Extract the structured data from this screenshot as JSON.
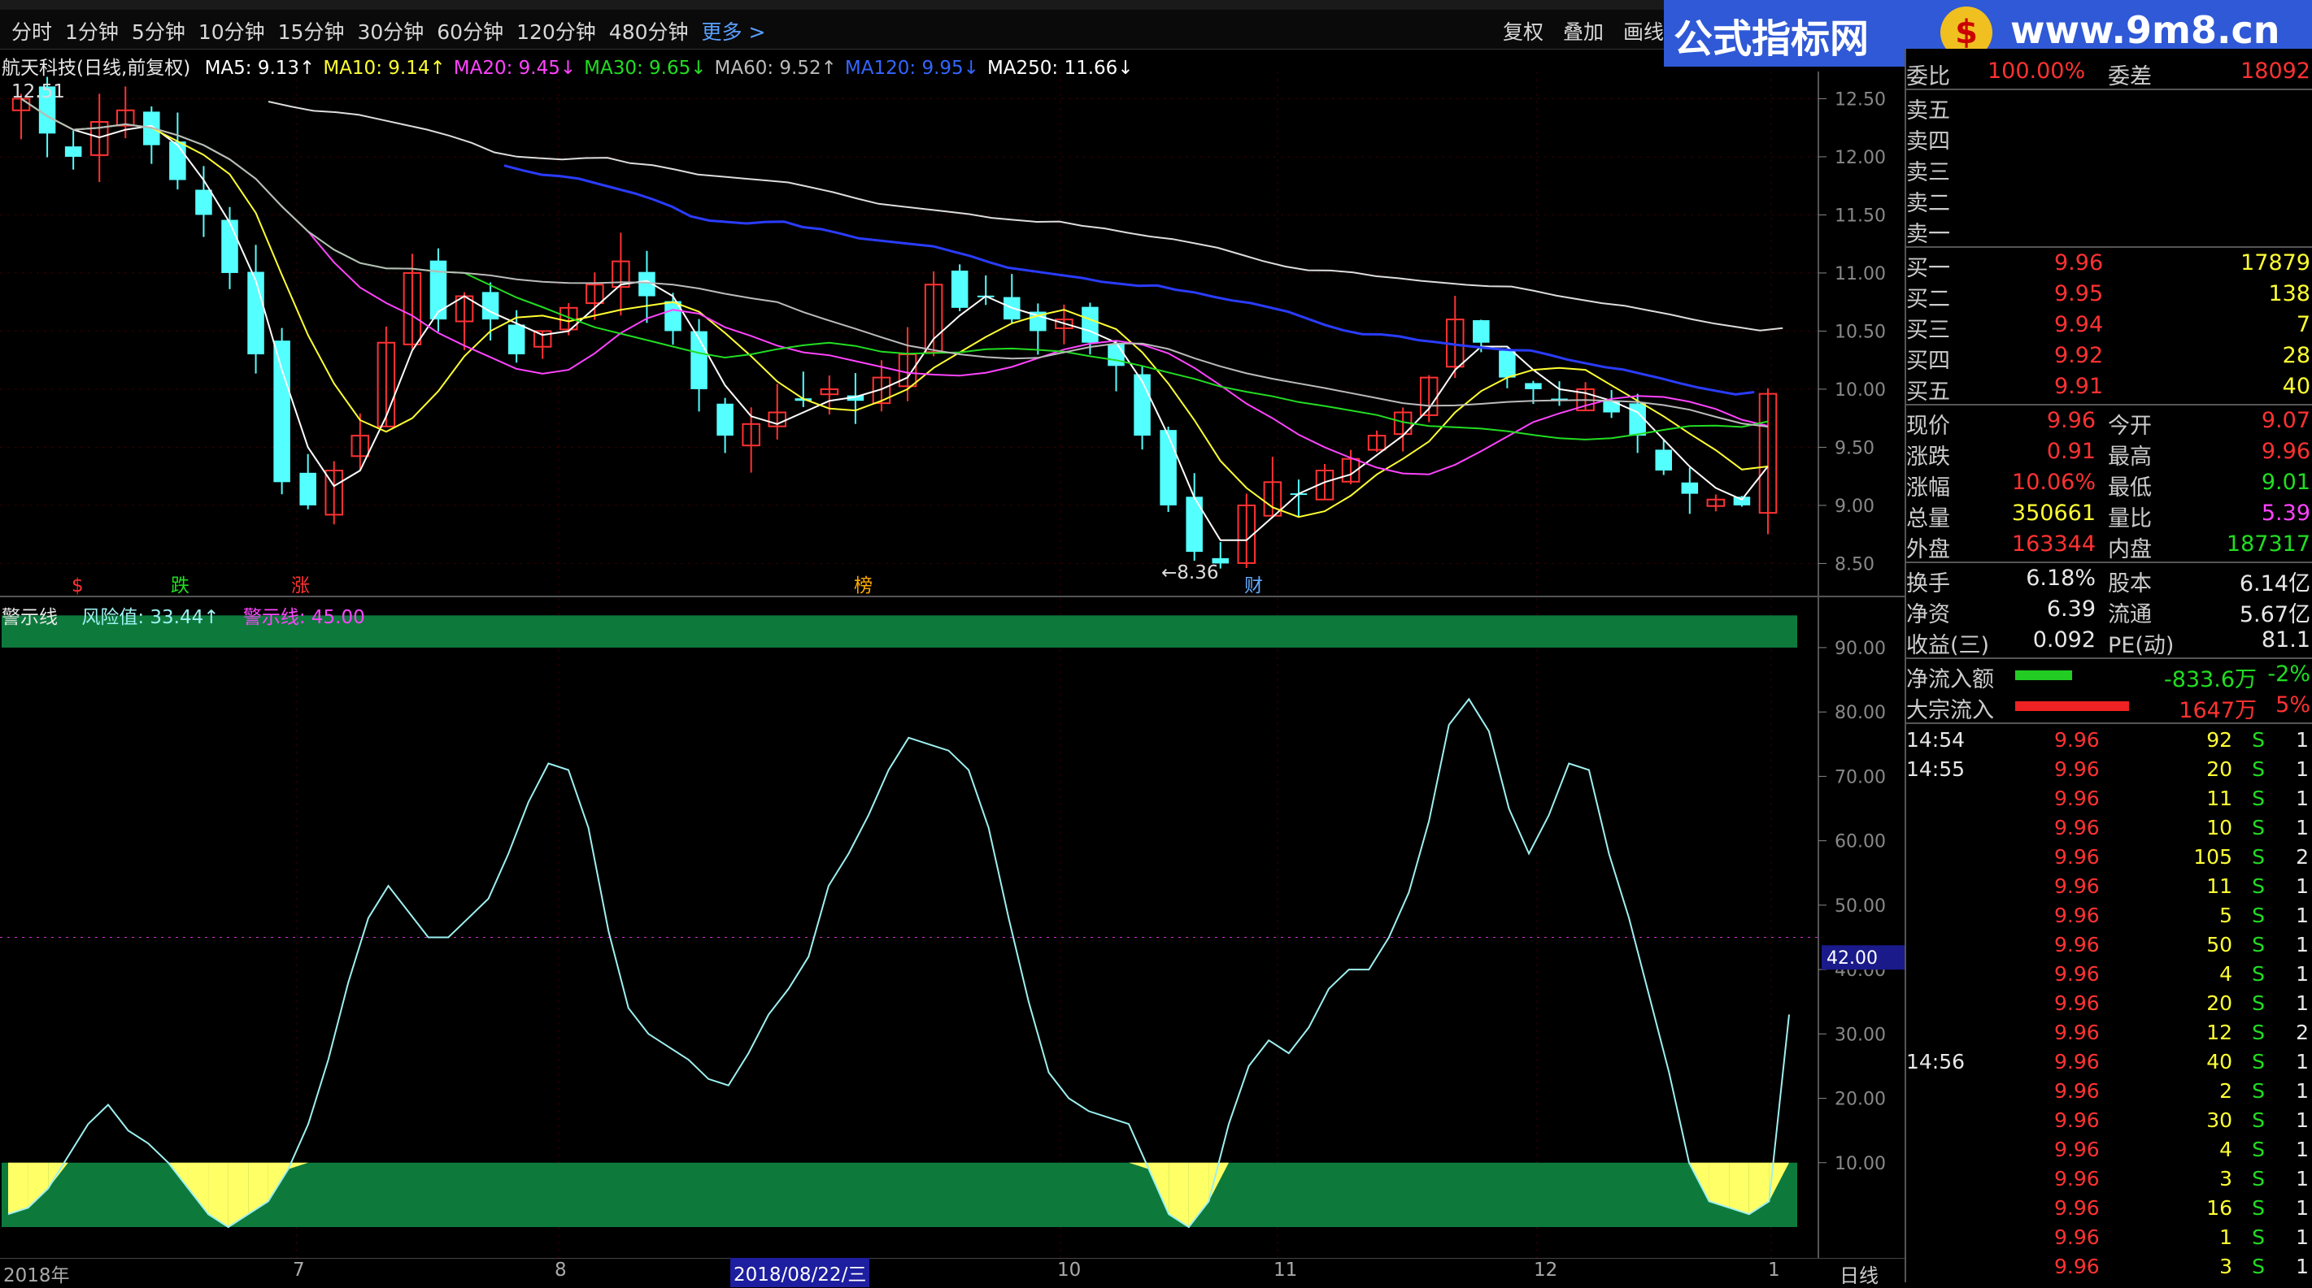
{
  "toolbar": {
    "periods": [
      "分时",
      "1分钟",
      "5分钟",
      "10分钟",
      "15分钟",
      "30分钟",
      "60分钟",
      "120分钟",
      "480分钟",
      "更多 >"
    ],
    "tools": [
      "复权",
      "叠加",
      "画线"
    ]
  },
  "brand": {
    "name": "公式指标网",
    "url": "www.9m8.cn",
    "logo_glyph": "$"
  },
  "chart_header": {
    "title": "航天科技(日线,前复权)",
    "ma": [
      {
        "label": "MA5: 9.13↑",
        "color": "#ffffff"
      },
      {
        "label": "MA10: 9.14↑",
        "color": "#ffff33"
      },
      {
        "label": "MA20: 9.45↓",
        "color": "#ff44ff"
      },
      {
        "label": "MA30: 9.65↓",
        "color": "#22dd22"
      },
      {
        "label": "MA60: 9.52↑",
        "color": "#bbbbbb"
      },
      {
        "label": "MA120: 9.95↓",
        "color": "#3366ff"
      },
      {
        "label": "MA250: 11.66↓",
        "color": "#ffffff"
      }
    ]
  },
  "price_axis": [
    "12.50",
    "12.00",
    "11.50",
    "11.00",
    "10.50",
    "10.00",
    "9.50",
    "9.00",
    "8.50"
  ],
  "high_label": "12.51",
  "low_label": "←8.36",
  "event_markers": [
    {
      "text": "$",
      "color": "#ff3232"
    },
    {
      "text": "跌",
      "color": "#22dd22"
    },
    {
      "text": "涨",
      "color": "#ff3232"
    },
    {
      "text": "榜",
      "color": "#ffaa00"
    },
    {
      "text": "财",
      "color": "#66aaff"
    }
  ],
  "indicator": {
    "name": "警示线",
    "risk_label": "风险值: 33.44↑",
    "warn_label": "警示线: 45.00",
    "axis": [
      "90.00",
      "80.00",
      "70.00",
      "60.00",
      "50.00",
      "40.00",
      "30.00",
      "20.00",
      "10.00"
    ],
    "cursor_value": "42.00"
  },
  "dates": {
    "labels": [
      "2018年",
      "7",
      "8",
      "10",
      "11",
      "12",
      "1"
    ],
    "selected": "2018/08/22/三",
    "mode": "日线"
  },
  "panel": {
    "weibi": {
      "label": "委比",
      "value": "100.00%",
      "label2": "委差",
      "value2": "18092"
    },
    "sell": [
      {
        "label": "卖五"
      },
      {
        "label": "卖四"
      },
      {
        "label": "卖三"
      },
      {
        "label": "卖二"
      },
      {
        "label": "卖一"
      }
    ],
    "buy": [
      {
        "label": "买一",
        "price": "9.96",
        "vol": "17879"
      },
      {
        "label": "买二",
        "price": "9.95",
        "vol": "138"
      },
      {
        "label": "买三",
        "price": "9.94",
        "vol": "7"
      },
      {
        "label": "买四",
        "price": "9.92",
        "vol": "28"
      },
      {
        "label": "买五",
        "price": "9.91",
        "vol": "40"
      }
    ],
    "quote": [
      {
        "l1": "现价",
        "v1": "9.96",
        "l2": "今开",
        "v2": "9.07",
        "c1": "red",
        "c2": "red"
      },
      {
        "l1": "涨跌",
        "v1": "0.91",
        "l2": "最高",
        "v2": "9.96",
        "c1": "red",
        "c2": "red"
      },
      {
        "l1": "涨幅",
        "v1": "10.06%",
        "l2": "最低",
        "v2": "9.01",
        "c1": "red",
        "c2": "green"
      },
      {
        "l1": "总量",
        "v1": "350661",
        "l2": "量比",
        "v2": "5.39",
        "c1": "yellow",
        "c2": "magenta"
      },
      {
        "l1": "外盘",
        "v1": "163344",
        "l2": "内盘",
        "v2": "187317",
        "c1": "red",
        "c2": "green"
      }
    ],
    "fund": [
      {
        "l1": "换手",
        "v1": "6.18%",
        "l2": "股本",
        "v2": "6.14亿"
      },
      {
        "l1": "净资",
        "v1": "6.39",
        "l2": "流通",
        "v2": "5.67亿"
      },
      {
        "l1": "收益(三)",
        "v1": "0.092",
        "l2": "PE(动)",
        "v2": "81.1"
      }
    ],
    "flow": [
      {
        "label": "净流入额",
        "value": "-833.6万",
        "pct": "-2%",
        "color": "green",
        "fill": 0.28
      },
      {
        "label": "大宗流入",
        "value": "1647万",
        "pct": "5%",
        "color": "red",
        "fill": 0.56
      }
    ],
    "ticks": [
      {
        "time": "14:54",
        "price": "9.96",
        "vol": "92",
        "side": "S",
        "n": "1"
      },
      {
        "time": "14:55",
        "price": "9.96",
        "vol": "20",
        "side": "S",
        "n": "1"
      },
      {
        "time": "",
        "price": "9.96",
        "vol": "11",
        "side": "S",
        "n": "1"
      },
      {
        "time": "",
        "price": "9.96",
        "vol": "10",
        "side": "S",
        "n": "1"
      },
      {
        "time": "",
        "price": "9.96",
        "vol": "105",
        "side": "S",
        "n": "2"
      },
      {
        "time": "",
        "price": "9.96",
        "vol": "11",
        "side": "S",
        "n": "1"
      },
      {
        "time": "",
        "price": "9.96",
        "vol": "5",
        "side": "S",
        "n": "1"
      },
      {
        "time": "",
        "price": "9.96",
        "vol": "50",
        "side": "S",
        "n": "1"
      },
      {
        "time": "",
        "price": "9.96",
        "vol": "4",
        "side": "S",
        "n": "1"
      },
      {
        "time": "",
        "price": "9.96",
        "vol": "20",
        "side": "S",
        "n": "1"
      },
      {
        "time": "",
        "price": "9.96",
        "vol": "12",
        "side": "S",
        "n": "2"
      },
      {
        "time": "14:56",
        "price": "9.96",
        "vol": "40",
        "side": "S",
        "n": "1"
      },
      {
        "time": "",
        "price": "9.96",
        "vol": "2",
        "side": "S",
        "n": "1"
      },
      {
        "time": "",
        "price": "9.96",
        "vol": "30",
        "side": "S",
        "n": "1"
      },
      {
        "time": "",
        "price": "9.96",
        "vol": "4",
        "side": "S",
        "n": "1"
      },
      {
        "time": "",
        "price": "9.96",
        "vol": "3",
        "side": "S",
        "n": "1"
      },
      {
        "time": "",
        "price": "9.96",
        "vol": "16",
        "side": "S",
        "n": "1"
      },
      {
        "time": "",
        "price": "9.96",
        "vol": "1",
        "side": "S",
        "n": "1"
      },
      {
        "time": "",
        "price": "9.96",
        "vol": "3",
        "side": "S",
        "n": "1"
      }
    ]
  },
  "chart_data": {
    "type": "line",
    "title": "航天科技(日线,前复权)",
    "price_range": [
      8.3,
      12.65
    ],
    "closes": [
      12.5,
      12.2,
      12.0,
      12.3,
      12.4,
      12.1,
      11.8,
      11.5,
      11.0,
      10.3,
      9.2,
      9.0,
      9.3,
      9.6,
      10.4,
      11.0,
      10.6,
      10.8,
      10.6,
      10.3,
      10.5,
      10.7,
      10.9,
      11.1,
      10.8,
      10.5,
      10.0,
      9.6,
      9.7,
      9.8,
      9.9,
      10.0,
      9.9,
      10.1,
      10.3,
      10.9,
      10.7,
      10.8,
      10.6,
      10.5,
      10.6,
      10.4,
      10.2,
      9.6,
      9.0,
      8.6,
      8.5,
      9.0,
      9.2,
      9.1,
      9.3,
      9.4,
      9.6,
      9.8,
      10.1,
      10.6,
      10.4,
      10.1,
      10.0,
      9.9,
      10.0,
      9.8,
      9.6,
      9.3,
      9.1,
      9.05,
      9.0,
      9.96
    ],
    "risk_values": [
      2,
      3,
      6,
      11,
      16,
      19,
      15,
      13,
      10,
      6,
      2,
      0,
      2,
      4,
      9,
      16,
      26,
      38,
      48,
      53,
      49,
      45,
      45,
      48,
      51,
      58,
      66,
      72,
      71,
      62,
      46,
      34,
      30,
      28,
      26,
      23,
      22,
      27,
      33,
      37,
      42,
      53,
      58,
      64,
      71,
      76,
      75,
      74,
      71,
      62,
      48,
      35,
      24,
      20,
      18,
      17,
      16,
      9,
      2,
      0,
      4,
      16,
      25,
      29,
      27,
      31,
      37,
      40,
      40,
      45,
      52,
      63,
      78,
      82,
      77,
      65,
      58,
      64,
      72,
      71,
      58,
      48,
      36,
      24,
      10,
      4,
      3,
      2,
      4,
      33
    ],
    "series": [
      {
        "name": "风险值",
        "color": "#9ef0f0"
      },
      {
        "name": "警示线",
        "color": "#ff44ff",
        "value": 45.0
      }
    ],
    "ylim": [
      0,
      100
    ],
    "zones": [
      {
        "from": 0,
        "to": 10,
        "color": "#0d7a3c"
      },
      {
        "from": 90,
        "to": 95,
        "color": "#0d7a3c"
      }
    ]
  }
}
